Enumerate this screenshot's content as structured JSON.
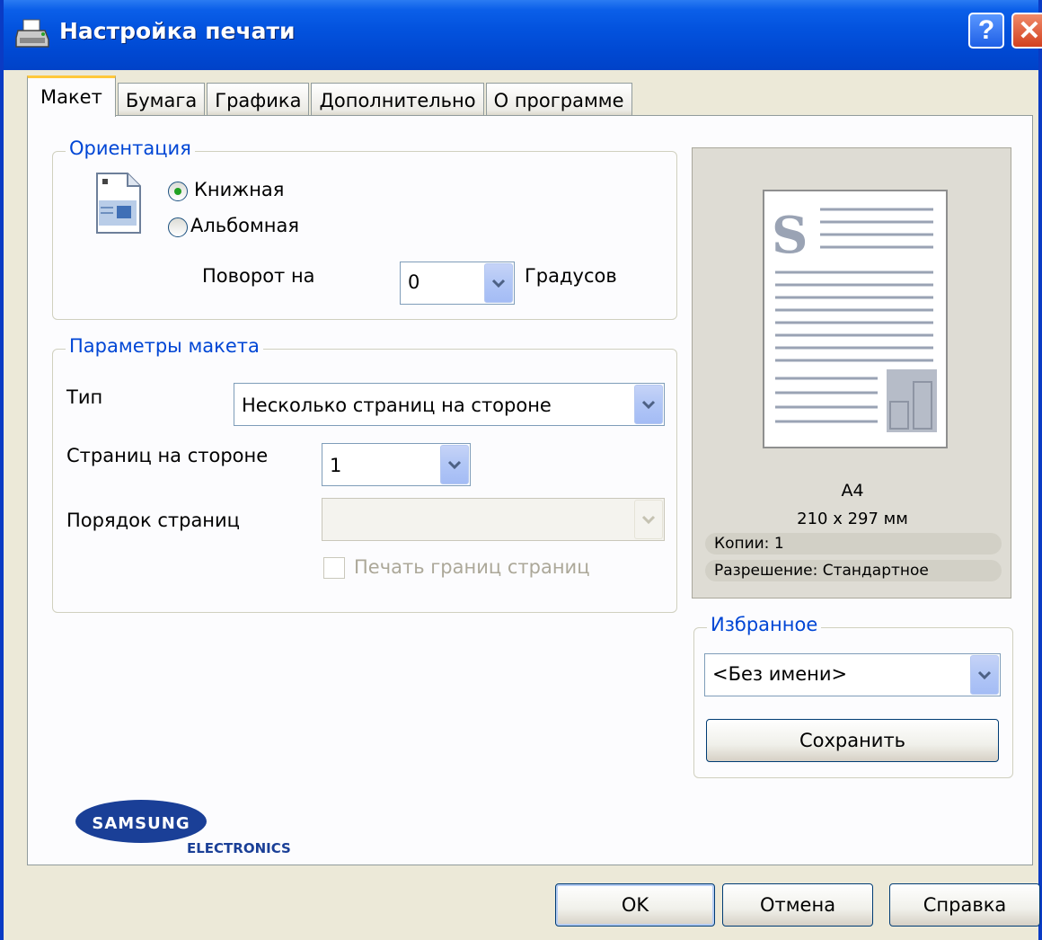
{
  "window": {
    "title": "Настройка печати",
    "help_label": "?",
    "close_label": "✕"
  },
  "tabs": [
    {
      "label": "Макет",
      "active": true
    },
    {
      "label": "Бумага",
      "active": false
    },
    {
      "label": "Графика",
      "active": false
    },
    {
      "label": "Дополнительно",
      "active": false
    },
    {
      "label": "О программе",
      "active": false
    }
  ],
  "orientation": {
    "group_label": "Ориентация",
    "portrait_label": "Книжная",
    "landscape_label": "Альбомная",
    "selected": "portrait",
    "rotate_label": "Поворот на",
    "rotate_value": "0",
    "degrees_label": "Градусов"
  },
  "layout": {
    "group_label": "Параметры макета",
    "type_label": "Тип",
    "type_value": "Несколько страниц на стороне",
    "pages_per_side_label": "Страниц на стороне",
    "pages_per_side_value": "1",
    "page_order_label": "Порядок страниц",
    "page_order_value": "",
    "print_borders_label": "Печать границ страниц"
  },
  "preview": {
    "paper_name": "A4",
    "paper_size": "210 x 297 мм",
    "copies": "Копии: 1",
    "resolution": "Разрешение: Стандартное"
  },
  "favorites": {
    "group_label": "Избранное",
    "value": "<Без имени>",
    "save_label": "Сохранить"
  },
  "logo": {
    "brand": "SAMSUNG",
    "sub": "ELECTRONICS"
  },
  "buttons": {
    "ok": "OK",
    "cancel": "Отмена",
    "help": "Справка"
  },
  "colors": {
    "titlebar": "#0353de",
    "group_label": "#0046d5",
    "tab_active_accent": "#ffc83c",
    "samsung_blue": "#1a3f97"
  },
  "icons": {
    "title": "printer-icon",
    "orientation": "document-portrait-icon",
    "dropdown": "chevron-down-icon"
  }
}
